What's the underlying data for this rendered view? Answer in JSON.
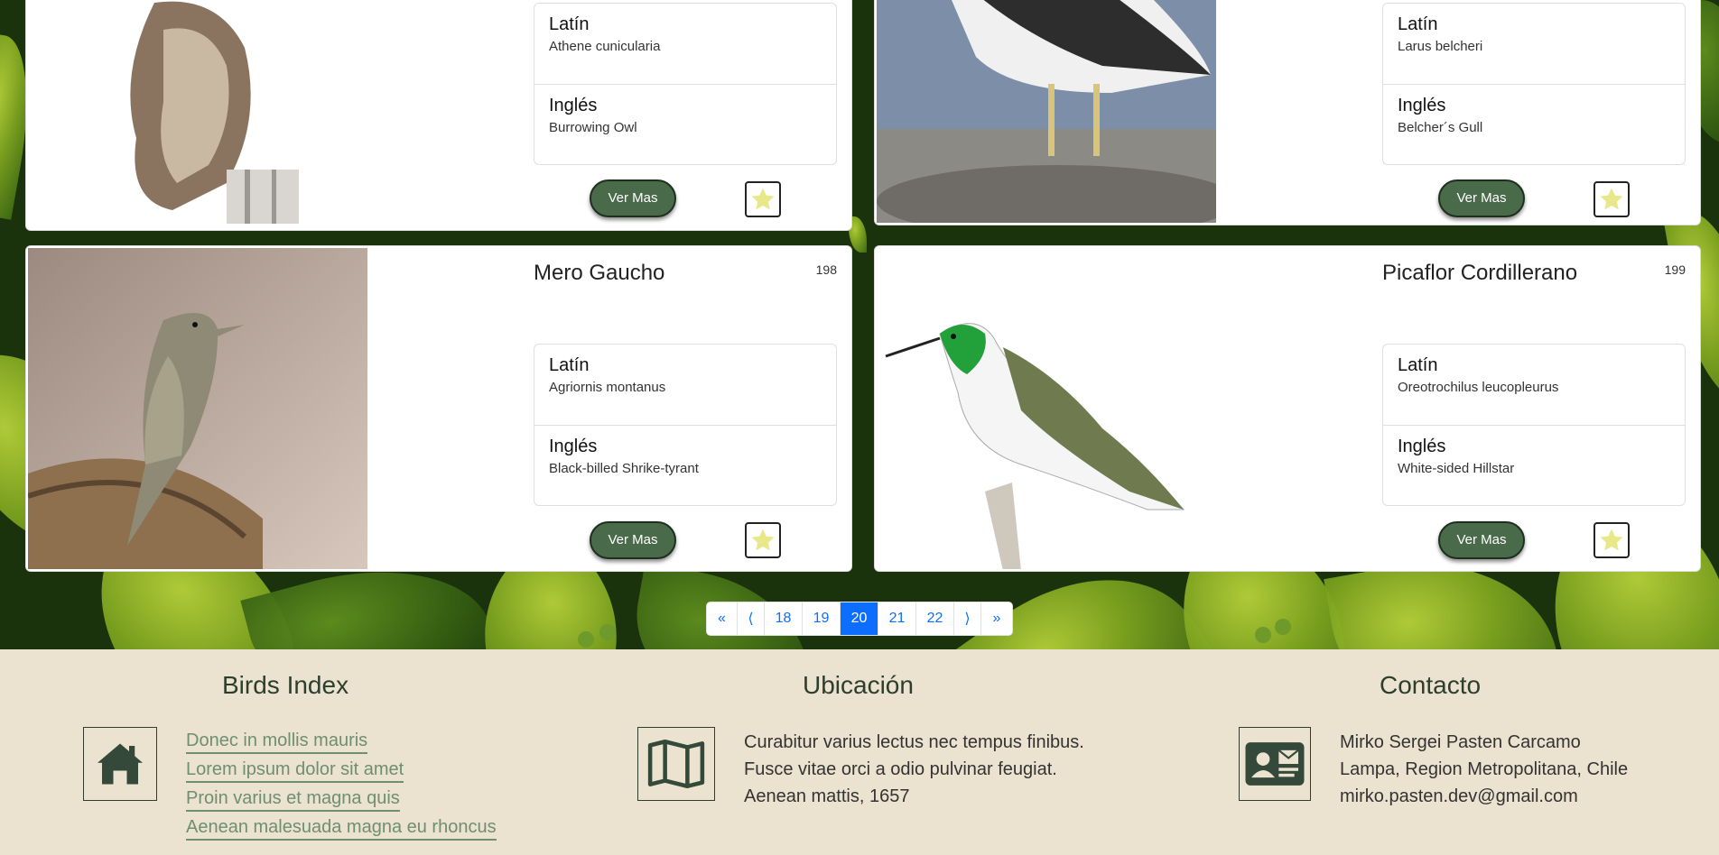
{
  "cards": [
    {
      "title": "",
      "number": "",
      "latin_label": "Latín",
      "latin": "Athene cunicularia",
      "english_label": "Inglés",
      "english": "Burrowing Owl",
      "button": "Ver Mas"
    },
    {
      "title": "",
      "number": "",
      "latin_label": "Latín",
      "latin": "Larus belcheri",
      "english_label": "Inglés",
      "english": "Belcher´s Gull",
      "button": "Ver Mas"
    },
    {
      "title": "Mero Gaucho",
      "number": "198",
      "latin_label": "Latín",
      "latin": "Agriornis montanus",
      "english_label": "Inglés",
      "english": "Black-billed Shrike-tyrant",
      "button": "Ver Mas"
    },
    {
      "title": "Picaflor Cordillerano",
      "number": "199",
      "latin_label": "Latín",
      "latin": "Oreotrochilus leucopleurus",
      "english_label": "Inglés",
      "english": "White-sided Hillstar",
      "button": "Ver Mas"
    }
  ],
  "pagination": {
    "first": "«",
    "prev": "⟨",
    "pages": [
      "18",
      "19",
      "20",
      "21",
      "22"
    ],
    "active": "20",
    "next": "⟩",
    "last": "»"
  },
  "footer": {
    "brand": {
      "title": "Birds Index",
      "icon": "house-icon",
      "links": [
        "Donec in mollis mauris",
        "Lorem ipsum dolor sit amet",
        "Proin varius et magna quis",
        "Aenean malesuada magna eu rhoncus"
      ]
    },
    "location": {
      "title": "Ubicación",
      "icon": "map-icon",
      "lines": [
        "Curabitur varius lectus nec tempus finibus.",
        "Fusce vitae orci a odio pulvinar feugiat.",
        "Aenean mattis, 1657"
      ]
    },
    "contact": {
      "title": "Contacto",
      "icon": "contact-card-icon",
      "lines": [
        "Mirko Sergei Pasten Carcamo",
        "Lampa, Region Metropolitana, Chile",
        "mirko.pasten.dev@gmail.com"
      ]
    }
  },
  "colors": {
    "button": "#4a6b4a",
    "star": "#e8e88a",
    "footer_bg": "#ebe2cf",
    "active_page": "#0d6efd"
  }
}
